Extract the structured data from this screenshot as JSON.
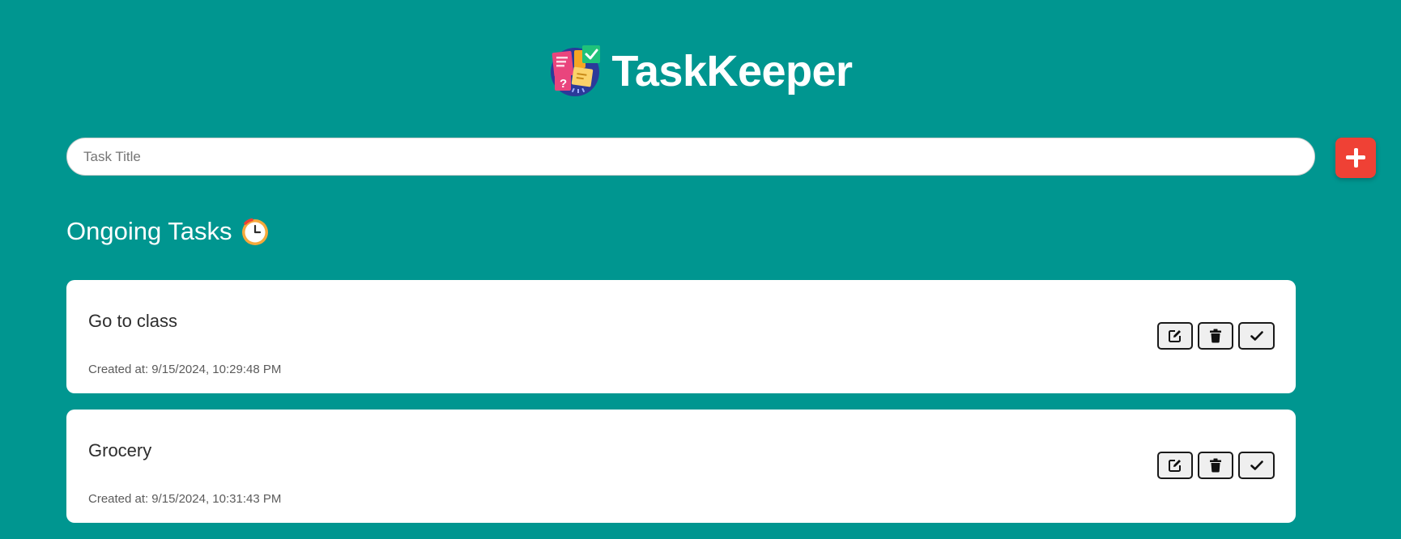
{
  "header": {
    "app_title": "TaskKeeper",
    "logo_icon": "sticky-notes-logo-icon"
  },
  "new_task": {
    "placeholder": "Task Title",
    "value": "",
    "add_icon": "plus-icon"
  },
  "section": {
    "title": "Ongoing Tasks",
    "icon": "stopwatch-icon"
  },
  "tasks": [
    {
      "title": "Go to class",
      "created_label": "Created at:",
      "created_value": "9/15/2024, 10:29:48 PM"
    },
    {
      "title": "Grocery",
      "created_label": "Created at:",
      "created_value": "9/15/2024, 10:31:43 PM"
    }
  ],
  "task_actions": {
    "edit_icon": "edit-icon",
    "delete_icon": "trash-icon",
    "complete_icon": "check-icon"
  },
  "colors": {
    "background": "#009690",
    "card": "#ffffff",
    "add_button": "#ef4135",
    "action_button": "#efefef"
  }
}
